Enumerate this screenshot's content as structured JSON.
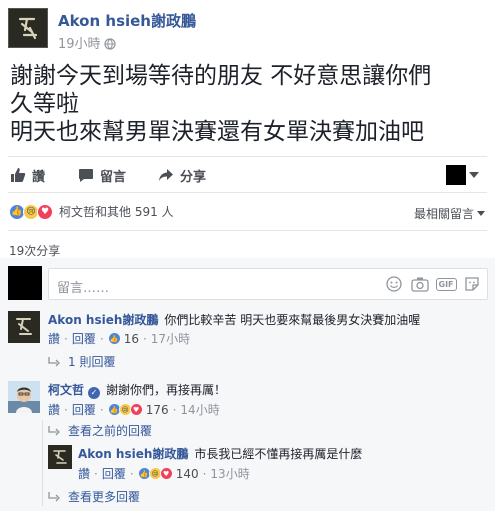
{
  "post": {
    "author": "Akon hsieh謝政鵬",
    "time": "19小時",
    "text_lines": [
      "謝謝今天到場等待的朋友 不好意思讓你們",
      "久等啦",
      "明天也來幫男單決賽還有女單決賽加油吧"
    ]
  },
  "actions": {
    "like": "讚",
    "comment": "留言",
    "share": "分享"
  },
  "reactions": {
    "summary": "柯文哲和其他 591 人",
    "sort_label": "最相關留言"
  },
  "shares": "19次分享",
  "composer": {
    "placeholder": "留言……",
    "tools": [
      "emoji-icon",
      "camera-icon",
      "gif-icon",
      "sticker-icon"
    ]
  },
  "comments": [
    {
      "author": "Akon hsieh謝政鵬",
      "text": "你們比較辛苦 明天也要來幫最後男女決賽加油喔",
      "like_label": "讚",
      "reply_label": "回覆",
      "reaction_count": "16",
      "time": "17小時",
      "replies_link": "1 則回覆"
    },
    {
      "author": "柯文哲",
      "text": "謝謝你們，再接再厲！",
      "like_label": "讚",
      "reply_label": "回覆",
      "reaction_count": "176",
      "time": "14小時",
      "prev_replies_link": "查看之前的回覆",
      "reply": {
        "author": "Akon hsieh謝政鵬",
        "text": "市長我已經不懂再接再厲是什麼",
        "like_label": "讚",
        "reply_label": "回覆",
        "reaction_count": "140",
        "time": "13小時"
      },
      "more_replies_link": "查看更多回覆"
    }
  ],
  "colors": {
    "link": "#365899",
    "meta": "#90949c",
    "like_blue": "#4f83e0",
    "love_red": "#f0415c",
    "sad_yellow": "#f7c948"
  }
}
